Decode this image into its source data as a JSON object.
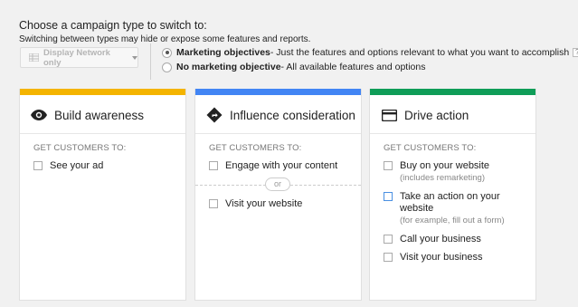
{
  "header": {
    "title": "Choose a campaign type to switch to:",
    "subtitle": "Switching between types may hide or expose some features and reports."
  },
  "network_select": {
    "value": "Display Network only",
    "icon": "grid-icon"
  },
  "radios": [
    {
      "bold": "Marketing objectives",
      "rest": " - Just the features and options relevant to what you want to accomplish",
      "checked": true,
      "help": "?"
    },
    {
      "bold": "No marketing objective",
      "rest": " - All available features and options",
      "checked": false
    }
  ],
  "get_customers_label": "GET CUSTOMERS TO:",
  "or_label": "or",
  "cards": {
    "awareness": {
      "title": "Build awareness",
      "icon": "eye-icon",
      "color": "#f4b400",
      "options": [
        {
          "label": "See your ad",
          "sub": ""
        }
      ]
    },
    "consideration": {
      "title": "Influence consideration",
      "icon": "directions-icon",
      "color": "#4285f4",
      "options": [
        {
          "label": "Engage with your content",
          "sub": ""
        },
        {
          "label": "Visit your website",
          "sub": ""
        }
      ]
    },
    "action": {
      "title": "Drive action",
      "icon": "credit-card-icon",
      "color": "#0f9d58",
      "options": [
        {
          "label": "Buy on your website",
          "sub": "(includes remarketing)"
        },
        {
          "label": "Take an action on your website",
          "sub": "(for example, fill out a form)"
        },
        {
          "label": "Call your business",
          "sub": ""
        },
        {
          "label": "Visit your business",
          "sub": ""
        }
      ]
    }
  }
}
